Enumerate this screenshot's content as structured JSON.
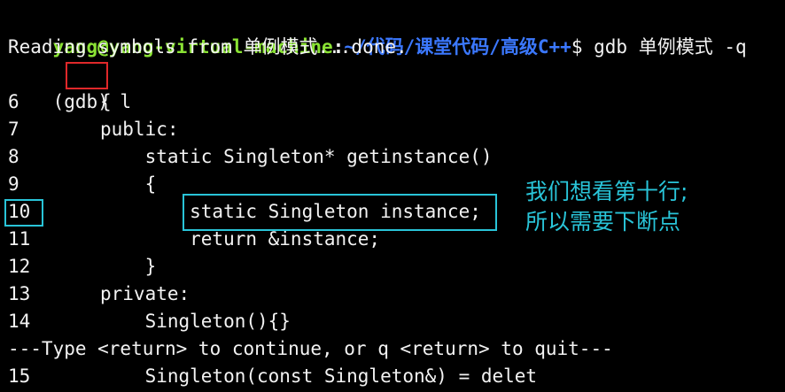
{
  "prompt": {
    "user_host": "yang@yang-virtual-machine",
    "separator": ":",
    "path": "~/代码/课堂代码/高级C++",
    "dollar": "$",
    "command": " gdb 单例模式 -q"
  },
  "output": {
    "reading": "Reading symbols from 单例模式...done."
  },
  "gdb_prompt": {
    "label": "(gdb)",
    "command": "l"
  },
  "listing": [
    {
      "num": "6",
      "code": "{"
    },
    {
      "num": "7",
      "code": "public:"
    },
    {
      "num": "8",
      "code": "    static Singleton* getinstance()"
    },
    {
      "num": "9",
      "code": "    {"
    },
    {
      "num": "10",
      "code": "        static Singleton instance;"
    },
    {
      "num": "11",
      "code": "        return &instance;"
    },
    {
      "num": "12",
      "code": "    }"
    },
    {
      "num": "13",
      "code": "private:"
    },
    {
      "num": "14",
      "code": "    Singleton(){}"
    }
  ],
  "pager": "---Type <return> to continue, or q <return> to quit---",
  "last_line": {
    "num": "15",
    "code": "    Singleton(const Singleton&) = delet"
  },
  "annotation": {
    "line1": "我们想看第十行;",
    "line2": "所以需要下断点"
  },
  "colors": {
    "background": "#000000",
    "prompt_user": "#8ae234",
    "prompt_path": "#3b78ff",
    "highlight_red": "#e0282a",
    "highlight_cyan": "#29c4d8"
  }
}
